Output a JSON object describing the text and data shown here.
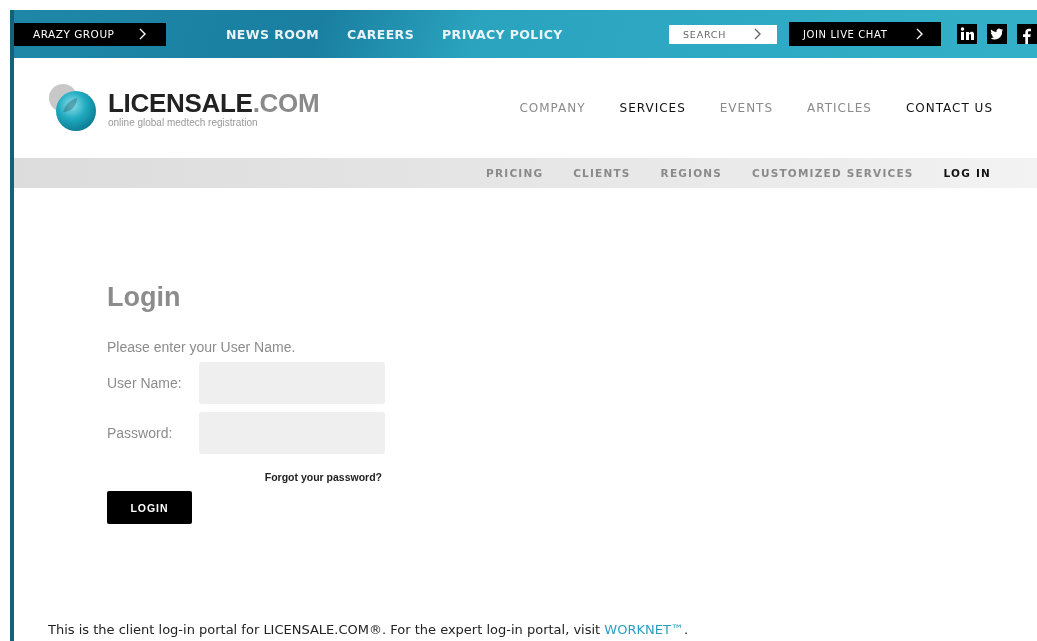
{
  "top_bar": {
    "group_button": "ARAZY GROUP",
    "links": [
      "NEWS ROOM",
      "CAREERS",
      "PRIVACY POLICY"
    ],
    "search": {
      "placeholder": "SEARCH"
    },
    "chat_button": "JOIN LIVE CHAT"
  },
  "logo": {
    "name": "LICENSALE",
    "suffix": ".COM",
    "tagline": "online global medtech registration"
  },
  "main_nav": [
    {
      "label": "COMPANY",
      "emphasized": false
    },
    {
      "label": "SERVICES",
      "emphasized": true
    },
    {
      "label": "EVENTS",
      "emphasized": false
    },
    {
      "label": "ARTICLES",
      "emphasized": false
    },
    {
      "label": "CONTACT US",
      "emphasized": true
    }
  ],
  "sub_nav": [
    {
      "label": "PRICING",
      "selected": false
    },
    {
      "label": "CLIENTS",
      "selected": false
    },
    {
      "label": "REGIONS",
      "selected": false
    },
    {
      "label": "CUSTOMIZED SERVICES",
      "selected": false
    },
    {
      "label": "LOG IN",
      "selected": true
    }
  ],
  "login": {
    "title": "Login",
    "prompt": "Please enter your User Name.",
    "fields": [
      {
        "label": "User Name:"
      },
      {
        "label": "Password:"
      }
    ],
    "forgot_link": "Forgot your password?",
    "button": "LOGIN"
  },
  "footer": {
    "text": "This is the client log-in portal for LICENSALE.COM®. For the expert log-in portal, visit ",
    "link": "WORKNET™",
    "end": "."
  }
}
